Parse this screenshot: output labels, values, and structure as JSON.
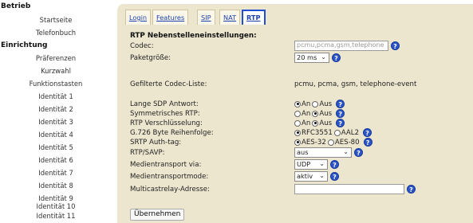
{
  "sidebar": {
    "betrieb": "Betrieb",
    "startseite": "Startseite",
    "telefonbuch": "Telefonbuch",
    "einrichtung": "Einrichtung",
    "praeferenzen": "Präferenzen",
    "kurzwahl": "Kurzwahl",
    "funktionstasten": "Funktionstasten",
    "identitaeten": [
      "Identität 1",
      "Identität 2",
      "Identität 3",
      "Identität 4",
      "Identität 5",
      "Identität 6",
      "Identität 7",
      "Identität 8",
      "Identität 9",
      "Identität 10",
      "Identität 11"
    ]
  },
  "tabs": {
    "login": "Login",
    "features": "Features",
    "sip": "SIP",
    "nat": "NAT",
    "rtp": "RTP"
  },
  "form": {
    "title": "RTP Nebenstelleneinstellungen:",
    "codec_label": "Codec:",
    "codec_value": "pcmu,pcma,gsm,telephone",
    "paket_label": "Paketgröße:",
    "paket_value": "20 ms",
    "gefiltert_label": "Gefilterte Codec-Liste:",
    "gefiltert_value": "pcmu, pcma, gsm, telephone-event",
    "sdp_label": "Lange SDP Antwort:",
    "sym_label": "Symmetrisches RTP:",
    "vers_label": "RTP Verschlüsselung:",
    "g726_label": "G.726 Byte Reihenfolge:",
    "srtp_label": "SRTP Auth-tag:",
    "savp_label": "RTP/SAVP:",
    "savp_value": "aus",
    "medtrans_label": "Medientransport via:",
    "medtrans_value": "UDP",
    "medmode_label": "Medientransportmode:",
    "medmode_value": "aktiv",
    "multicast_label": "Multicastrelay-Adresse:",
    "an": "An",
    "aus": "Aus",
    "rfc": "RFC3551",
    "aal2": "AAL2",
    "aes32": "AES-32",
    "aes80": "AES-80",
    "help": "?",
    "caret": "⌄",
    "submit": "Übernehmen"
  },
  "colors": {
    "accent": "#1f4fd0",
    "panel": "#ede6cf",
    "link": "#1a3fb0"
  }
}
